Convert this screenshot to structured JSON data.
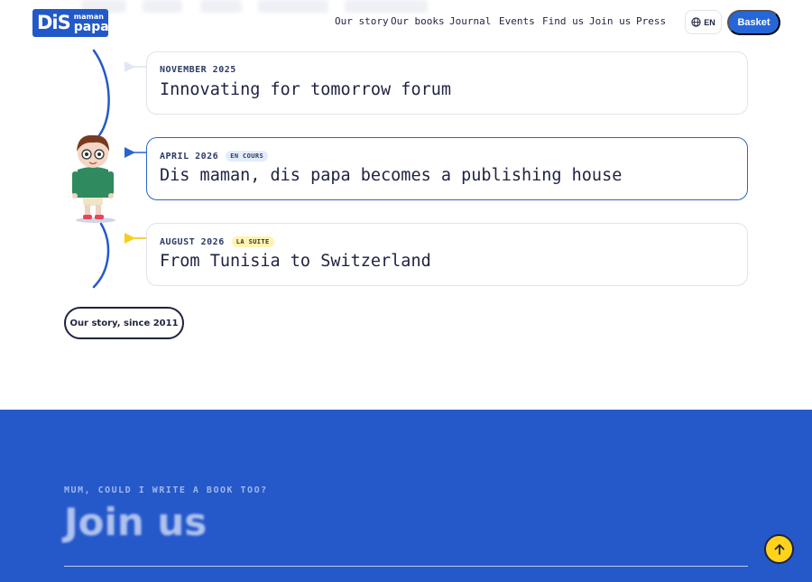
{
  "header": {
    "logo": {
      "big": "DiS",
      "small": "maman",
      "papa": "papa"
    },
    "nav": [
      "Our story",
      "Our books",
      "Journal",
      "Events",
      "Find us",
      "Join us",
      "Press"
    ],
    "language": "EN",
    "basket": "Basket"
  },
  "timeline": {
    "entries": [
      {
        "date": "NOVEMBER 2025",
        "badge": "",
        "title": "Innovating for tomorrow forum"
      },
      {
        "date": "APRIL 2026",
        "badge": "EN COURS",
        "title": "Dis maman, dis papa becomes a publishing house"
      },
      {
        "date": "AUGUST 2026",
        "badge": "LA SUITE",
        "title": "From Tunisia to Switzerland"
      }
    ],
    "story_button": "Our story, since 2011"
  },
  "join": {
    "eyebrow": "MUM, COULD I WRITE A BOOK TOO?",
    "title": "Join us"
  },
  "colors": {
    "brand_blue": "#2259c9",
    "accent_yellow": "#ffd21c",
    "text_dark": "#1f2340"
  }
}
